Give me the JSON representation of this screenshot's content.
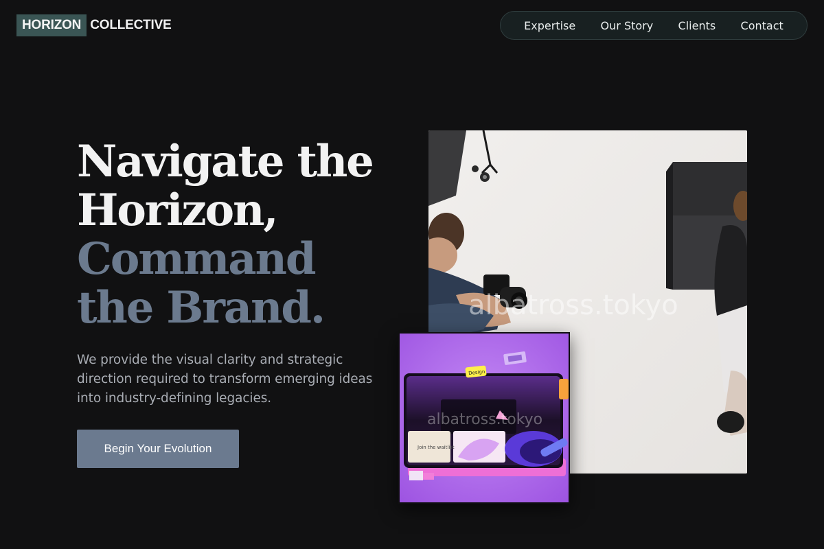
{
  "header": {
    "logo_box": "HORIZON",
    "logo_rest": "COLLECTIVE",
    "nav": [
      {
        "label": "Expertise"
      },
      {
        "label": "Our Story"
      },
      {
        "label": "Clients"
      },
      {
        "label": "Contact"
      }
    ]
  },
  "hero": {
    "headline_lines": [
      "Navigate the",
      "Horizon,",
      "Command",
      "the Brand."
    ],
    "subtext": "We provide the visual clarity and strategic direction required to transform emerging ideas into industry-defining legacies.",
    "cta_label": "Begin Your Evolution"
  },
  "images": {
    "main_watermark": "albatross.tokyo",
    "inset_watermark": "albatross.tokyo",
    "inset_sticker_label": "Design",
    "inset_card_caption": "Join the waitlist"
  },
  "colors": {
    "background": "#111112",
    "logo_box": "#3a5554",
    "accent_muted": "#6b7a8e",
    "cta": "#6b7a8f",
    "nav_bg": "#182021"
  }
}
